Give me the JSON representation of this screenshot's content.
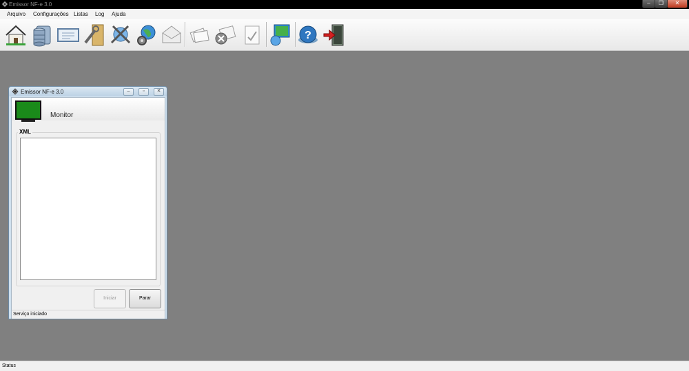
{
  "window": {
    "title": "Emissor NF-e 3.0"
  },
  "menu": [
    {
      "label": "Arquivo"
    },
    {
      "label": "Configurações"
    },
    {
      "label": "Listas"
    },
    {
      "label": "Log"
    },
    {
      "label": "Ajuda"
    }
  ],
  "toolbar": {
    "icons": [
      "home-icon",
      "database-icon",
      "certificate-icon",
      "tools-icon",
      "network-config-icon",
      "globe-gears-icon",
      "envelope-icon",
      "documents-icon",
      "cancel-document-icon",
      "sign-document-icon",
      "monitor-network-icon",
      "help-icon",
      "exit-icon"
    ]
  },
  "child_window": {
    "title": "Emissor NF-e 3.0",
    "header_label": "Monitor",
    "group_label": "XML",
    "xml_content": "",
    "start_button": "Iniciar",
    "stop_button": "Parar",
    "status": "Serviço iniciado"
  },
  "statusbar": {
    "text": "Status"
  },
  "colors": {
    "mdi_background": "#808080",
    "monitor_screen": "#1a8a1a"
  }
}
